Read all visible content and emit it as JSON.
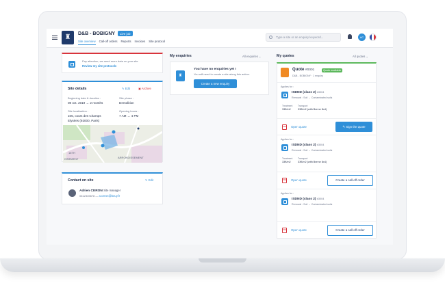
{
  "header": {
    "site_name": "D&B - BOBIGNY",
    "live_badge": "Live job",
    "tabs": [
      "Site overview",
      "Call-off orders",
      "Reports",
      "Invoices",
      "Site protocol"
    ],
    "search_placeholder": "Type a site or an enquiry keyword...",
    "user_initials": "AC"
  },
  "alert": {
    "message": "Pay attention, we need more data on your site",
    "link": "Review my site protocols"
  },
  "site_details": {
    "title": "Site details",
    "edit": "Edit",
    "archive": "Archive",
    "begin_label": "Beginning date & duration :",
    "begin_value": "08 oct. 2019 → 2 months",
    "phase_label": "Site phase :",
    "phase_value": "Demolition",
    "location_label": "Site localisation :",
    "location_value_1": "105, cours des Champs",
    "location_value_2": "Elysées (92000, Paris)",
    "hours_label": "Opening hours :",
    "hours_value": "7 AM → 4 PM",
    "map_label_1": "16TH",
    "map_label_2": "ARRONDISSEMENT",
    "map_label_3": "ISSEMENT"
  },
  "contact": {
    "title": "Contact on site",
    "edit": "Edit",
    "name": "Adrien CERON",
    "role": "Site manager",
    "phone": "0612345678",
    "email": "a.ceron@bouy.fr"
  },
  "enquiries": {
    "title": "My enquiries",
    "filter": "All enquiries",
    "empty_title": "You have no enquiries yet !",
    "empty_sub": "You will need to create a site along this action.",
    "create_button": "Create a new enquiry"
  },
  "quotes": {
    "title": "My quotes",
    "filter": "All quotes",
    "quote_title": "Quote",
    "quote_number": "#0001",
    "quote_badge": "Quote available",
    "quote_sub": "D&B - BOBIGNY · 1 enquiry",
    "applies_for": "Applies for :",
    "items": [
      {
        "name": "ISDND (class 2)",
        "code": "#3004",
        "desc": "Removal : Soil → Contaminated soils",
        "treat_label": "Treatment",
        "treat_value": "33€/m2",
        "transport_label": "Transport",
        "transport_value": "33€/m2 (with Benne 8x4)",
        "open": "Open quote",
        "action": "Sign the quote"
      },
      {
        "name": "ISDND (class 2)",
        "code": "#3004",
        "desc": "Removal : Soil → Contaminated soils",
        "treat_label": "Treatment",
        "treat_value": "33€/m2",
        "transport_label": "Transport",
        "transport_value": "33€/m2 (with Benne 8x4)",
        "open": "Open quote",
        "action": "Create a call-off order"
      },
      {
        "name": "ISDND (class 2)",
        "code": "#3004",
        "desc": "Removal : Soil → Contaminated soils",
        "open": "Open quote",
        "action": "Create a call-off order"
      }
    ]
  },
  "colors": {
    "accent": "#2f8fd8",
    "navy": "#1f3a6b",
    "green": "#5cb85c",
    "orange": "#f08a24",
    "red": "#d8343c"
  }
}
